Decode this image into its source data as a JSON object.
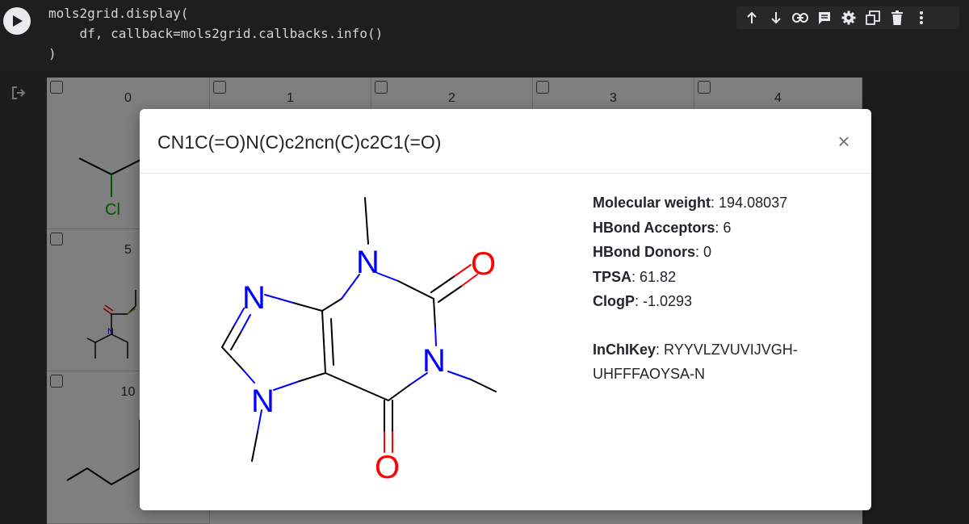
{
  "code": {
    "lines": [
      "mols2grid.display(",
      "    df, callback=mols2grid.callbacks.info()",
      ")"
    ]
  },
  "toolbar": {
    "icons": [
      "arrow-up-icon",
      "arrow-down-icon",
      "link-icon",
      "comment-icon",
      "gear-icon",
      "mirror-cell-icon",
      "trash-icon",
      "more-vert-icon"
    ]
  },
  "grid": {
    "column_indices": [
      "0",
      "1",
      "2",
      "3",
      "4"
    ],
    "row_indices": [
      "5",
      "10"
    ]
  },
  "modal": {
    "title": "CN1C(=O)N(C)c2ncn(C)c2C1(=O)",
    "close_label": "×",
    "properties": [
      {
        "label": "Molecular weight",
        "value": "194.08037"
      },
      {
        "label": "HBond Acceptors",
        "value": "6"
      },
      {
        "label": "HBond Donors",
        "value": "0"
      },
      {
        "label": "TPSA",
        "value": "61.82"
      },
      {
        "label": "ClogP",
        "value": "-1.0293"
      }
    ],
    "inchikey": {
      "label": "InChIKey",
      "value": "RYYVLZVUVIJVGH-",
      "value_line2": "UHFFFAOYSA-N"
    },
    "molecule_atoms": {
      "N": "N",
      "O": "O"
    }
  },
  "background_molecules": {
    "cl_label": "Cl"
  },
  "colors": {
    "nitrogen": "#0000ff",
    "oxygen": "#ff0000",
    "chlorine": "#00aa00",
    "sulfur": "#aaaa00"
  }
}
